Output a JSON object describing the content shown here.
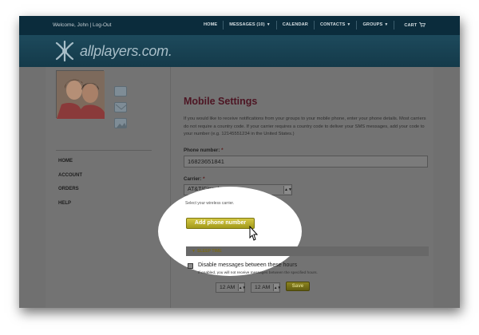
{
  "topbar": {
    "welcome": "Welcome, John | Log-Out",
    "nav": [
      {
        "label": "HOME",
        "caret": false
      },
      {
        "label": "MESSAGES (10)",
        "caret": true
      },
      {
        "label": "CALENDAR",
        "caret": false
      },
      {
        "label": "CONTACTS",
        "caret": true
      },
      {
        "label": "GROUPS",
        "caret": true
      },
      {
        "label": "CART",
        "caret": false
      }
    ]
  },
  "header": {
    "logo_text": "allplayers.com."
  },
  "sidebar": {
    "items": [
      {
        "label": "HOME"
      },
      {
        "label": "ACCOUNT"
      },
      {
        "label": "ORDERS"
      },
      {
        "label": "HELP"
      }
    ]
  },
  "main": {
    "title": "Mobile Settings",
    "intro": "If you would like to receive notifications from your groups to your mobile phone, enter your phone details. Most carriers do not require a country code. If your carrier requires a country code to deliver your SMS messages, add your code to your number (e.g. 12145551234 in the United States.)",
    "phone_label": "Phone number:",
    "required_mark": "*",
    "phone_value": "16823651841",
    "carrier_label": "Carrier:",
    "carrier_value": "AT&T/Cingular",
    "carrier_hint": "Select your wireless carrier.",
    "add_button": "Add phone number",
    "sleep_time": "SLEEP TIME",
    "disable_label": "Disable messages between these hours",
    "disable_help": "If enabled, you will not receive messages between the specified hours.",
    "time_from": "12 AM",
    "time_to": "12 AM",
    "save_button": "Save"
  },
  "colors": {
    "topbar": "#0b2c3c",
    "header": "#1d4a5c",
    "title": "#4d1523",
    "button": "#c9bd33",
    "dim_overlay": "#737373"
  }
}
